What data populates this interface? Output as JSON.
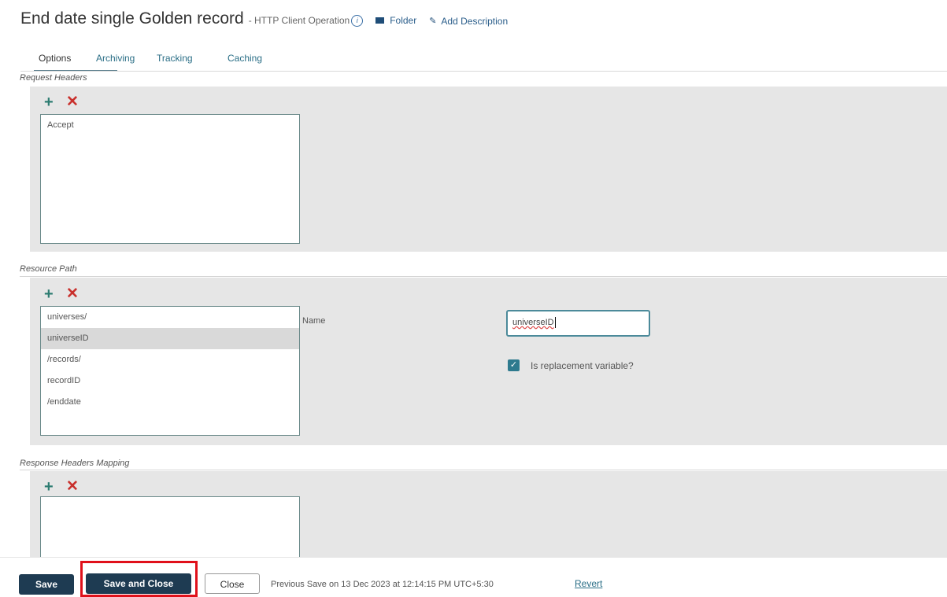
{
  "header": {
    "title": "End date single Golden record",
    "subtitle": "- HTTP Client Operation",
    "info_icon": "i",
    "folder_label": "Folder",
    "add_description_label": "Add Description"
  },
  "tabs": [
    {
      "label": "Options",
      "active": true
    },
    {
      "label": "Archiving",
      "active": false
    },
    {
      "label": "Tracking",
      "active": false
    },
    {
      "label": "Caching",
      "active": false
    }
  ],
  "request_headers": {
    "label": "Request Headers",
    "items": [
      "Accept"
    ]
  },
  "resource_path": {
    "label": "Resource Path",
    "items": [
      "universes/",
      "universeID",
      "/records/",
      "recordID",
      "/enddate"
    ],
    "selected_index": 1,
    "name_label": "Name",
    "name_value": "universeID",
    "replacement_label": "Is replacement variable?",
    "replacement_checked": true
  },
  "response_headers": {
    "label": "Response Headers Mapping",
    "items": []
  },
  "icons": {
    "add": "plus-icon",
    "remove": "cross-icon",
    "folder": "folder-icon",
    "edit": "pencil-icon",
    "info": "info-icon"
  },
  "colors": {
    "primary_button": "#1e3b52",
    "add_icon": "#2e7d72",
    "remove_icon": "#c9302c",
    "highlight": "#e0101a",
    "tab_link": "#2a6e86"
  },
  "footer": {
    "save_label": "Save",
    "save_close_label": "Save and Close",
    "close_label": "Close",
    "previous_save": "Previous Save on 13 Dec 2023 at 12:14:15 PM UTC+5:30",
    "revert_label": "Revert"
  }
}
